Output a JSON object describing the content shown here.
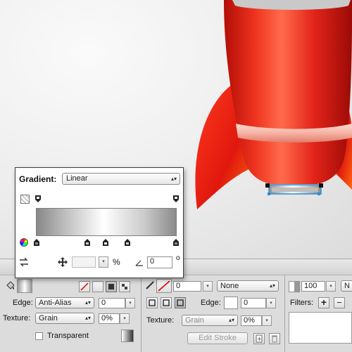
{
  "gradient_popup": {
    "title": "Gradient:",
    "type_value": "Linear",
    "angle_value": "0",
    "percent_symbol": "%",
    "degree_symbol": "o",
    "ramp_colors": [
      "#888888",
      "#ffffff",
      "#8a8a8a"
    ]
  },
  "fill_panel": {
    "edge_label": "Edge:",
    "edge_value": "Anti-Alias",
    "edge_amount": "0",
    "texture_label": "Texture:",
    "texture_value": "Grain",
    "texture_amount": "0%",
    "transparent_label": "Transparent"
  },
  "stroke_panel": {
    "stroke_size": "0",
    "stroke_type": "None",
    "edge_label": "Edge:",
    "edge_amount": "0",
    "texture_label": "Texture:",
    "texture_value": "Grain",
    "texture_amount": "0%",
    "edit_stroke_label": "Edit Stroke"
  },
  "effects_panel": {
    "opacity_value": "100",
    "filters_label": "Filters:",
    "add_filter_symbol": "+",
    "remove_filter_symbol": "−"
  },
  "colors": {
    "rocket_red": "#e8211a",
    "selection_blue": "#2a8fd8"
  }
}
